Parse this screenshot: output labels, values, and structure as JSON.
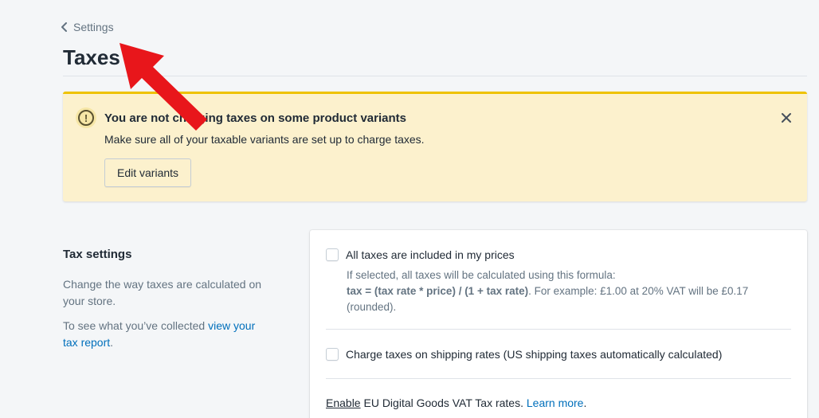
{
  "breadcrumb": {
    "label": "Settings"
  },
  "page": {
    "title": "Taxes"
  },
  "banner": {
    "title": "You are not charging taxes on some product variants",
    "body": "Make sure all of your taxable variants are set up to charge taxes.",
    "button_label": "Edit variants"
  },
  "tax_settings": {
    "title": "Tax settings",
    "description": "Change the way taxes are calculated on your store.",
    "report_prefix": "To see what you’ve collected ",
    "report_link": "view your tax report",
    "report_suffix": "."
  },
  "card": {
    "included": {
      "label": "All taxes are included in my prices",
      "help_line1": "If selected, all taxes will be calculated using this formula:",
      "formula": "tax = (tax rate * price) / (1 + tax rate)",
      "example": ". For example: £1.00 at 20% VAT will be £0.17 (rounded)."
    },
    "shipping": {
      "label": "Charge taxes on shipping rates (US shipping taxes automatically calculated)"
    },
    "eu": {
      "enable": "Enable",
      "text": " EU Digital Goods VAT Tax rates. ",
      "learn_more": "Learn more",
      "suffix": "."
    }
  },
  "colors": {
    "accent_link": "#006fbb",
    "banner_bg": "#fcf1cd",
    "banner_border": "#eec200",
    "annotation_arrow": "#e8161b"
  }
}
